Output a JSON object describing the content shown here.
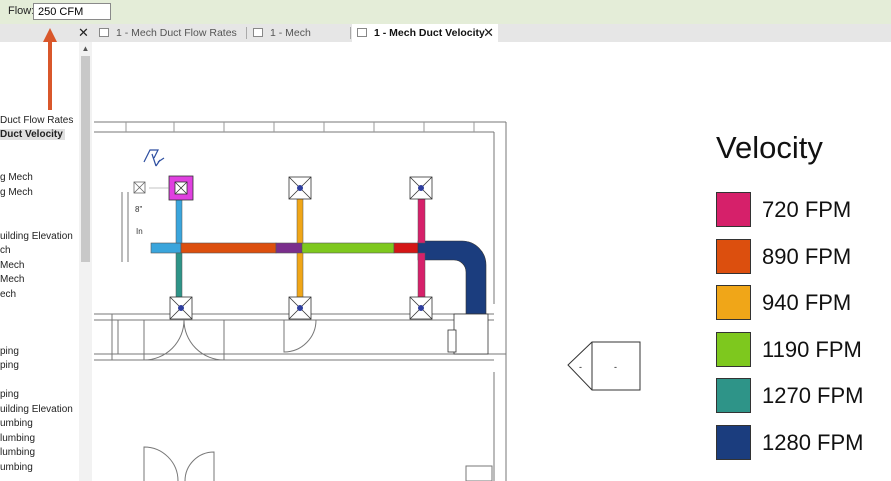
{
  "options_bar": {
    "flow_label": "Flow:",
    "flow_value": "250 CFM"
  },
  "tabs": [
    {
      "label": "1 - Mech Duct Flow Rates",
      "active": false
    },
    {
      "label": "1 - Mech",
      "active": false
    },
    {
      "label": "1 - Mech Duct Velocity",
      "active": true,
      "close": "✕"
    }
  ],
  "project_browser": {
    "close": "✕",
    "scroll_up": "▲",
    "items": [
      {
        "label": "Duct Flow Rates",
        "selected": false
      },
      {
        "label": "Duct Velocity",
        "selected": true
      },
      {
        "label": "g Mech",
        "selected": false
      },
      {
        "label": "g Mech",
        "selected": false
      },
      {
        "label": "uilding Elevation",
        "selected": false
      },
      {
        "label": "ch",
        "selected": false
      },
      {
        "label": "Mech",
        "selected": false
      },
      {
        "label": "Mech",
        "selected": false
      },
      {
        "label": "ech",
        "selected": false
      },
      {
        "label": "ping",
        "selected": false
      },
      {
        "label": "ping",
        "selected": false
      },
      {
        "label": "ping",
        "selected": false
      },
      {
        "label": "uilding Elevation",
        "selected": false
      },
      {
        "label": "umbing",
        "selected": false
      },
      {
        "label": "lumbing",
        "selected": false
      },
      {
        "label": "lumbing",
        "selected": false
      },
      {
        "label": "umbing",
        "selected": false
      }
    ]
  },
  "drawing": {
    "tag_size": "8\"",
    "tag_in": "In",
    "room_tag_left": "-",
    "room_tag_right": "-"
  },
  "legend": {
    "title": "Velocity",
    "items": [
      {
        "label": "720 FPM",
        "color": "#d6206a"
      },
      {
        "label": "890 FPM",
        "color": "#dc4f0e"
      },
      {
        "label": "940 FPM",
        "color": "#f0a618"
      },
      {
        "label": "1190 FPM",
        "color": "#7ec81e"
      },
      {
        "label": "1270 FPM",
        "color": "#2e9488"
      },
      {
        "label": "1280 FPM",
        "color": "#1b3d7e"
      }
    ]
  },
  "colors": {
    "annotation_arrow": "#d9572b",
    "selected_terminal": "#e040e0",
    "supply_light_blue": "#3aa5dc",
    "transition_purple": "#7a2e8c"
  }
}
